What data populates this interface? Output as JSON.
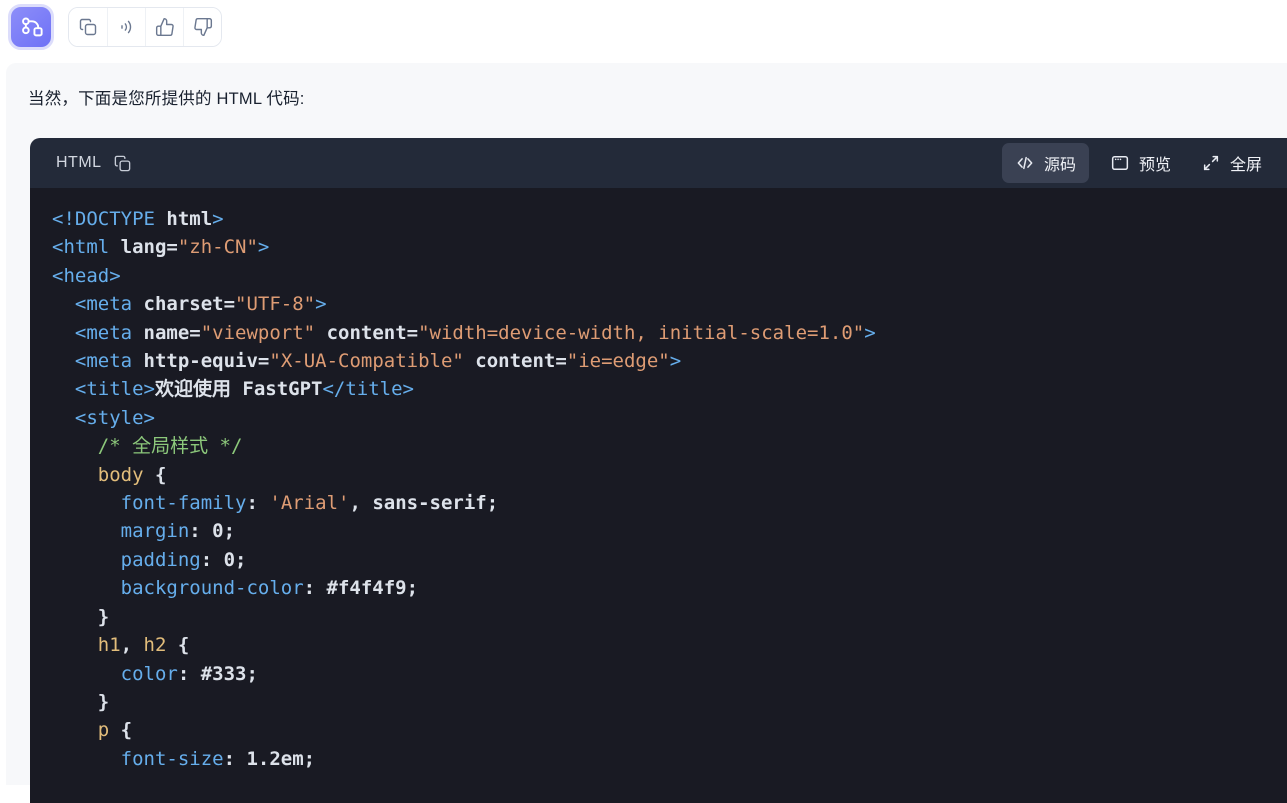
{
  "colors": {
    "avatar_purple": "#7a7df7",
    "avatar_ring": "#dcddfb",
    "bubble_bg": "#f7f8fa",
    "code_header_bg": "#232a39",
    "code_bg": "#191a23",
    "active_tab_bg": "#3a4153",
    "tag_blue": "#66aeec",
    "string_orange": "#de9c74",
    "comment_green": "#8cc87b",
    "selector_tan": "#e2bd7b",
    "code_text": "#dde2ea",
    "toolbar_icon_gray": "#6b7890"
  },
  "avatar": {
    "icon": "workflow-icon"
  },
  "toolbar": {
    "icons": [
      "copy-icon",
      "sound-icon",
      "thumbs-up-icon",
      "thumbs-down-icon"
    ]
  },
  "message": {
    "text": "当然，下面是您所提供的 HTML 代码:"
  },
  "code_block": {
    "language_label": "HTML",
    "header_icons": [
      "copy-icon",
      "code-icon",
      "window-icon",
      "expand-icon"
    ],
    "actions": {
      "source": {
        "label": "源码",
        "active": true
      },
      "preview": {
        "label": "预览",
        "active": false
      },
      "fullscreen": {
        "label": "全屏",
        "active": false
      }
    },
    "lines": [
      [
        [
          "t",
          "<!DOCTYPE "
        ],
        [
          "b",
          "html"
        ],
        [
          "t",
          ">"
        ]
      ],
      [
        [
          "t",
          "<html "
        ],
        [
          "b",
          "lang="
        ],
        [
          "s",
          "\"zh-CN\""
        ],
        [
          "t",
          ">"
        ]
      ],
      [
        [
          "t",
          "<head>"
        ]
      ],
      [
        [
          "b",
          "  "
        ],
        [
          "t",
          "<meta "
        ],
        [
          "b",
          "charset="
        ],
        [
          "s",
          "\"UTF-8\""
        ],
        [
          "t",
          ">"
        ]
      ],
      [
        [
          "b",
          "  "
        ],
        [
          "t",
          "<meta "
        ],
        [
          "b",
          "name="
        ],
        [
          "s",
          "\"viewport\""
        ],
        [
          "b",
          " content="
        ],
        [
          "s",
          "\"width=device-width, initial-scale=1.0\""
        ],
        [
          "t",
          ">"
        ]
      ],
      [
        [
          "b",
          "  "
        ],
        [
          "t",
          "<meta "
        ],
        [
          "b",
          "http-equiv="
        ],
        [
          "s",
          "\"X-UA-Compatible\""
        ],
        [
          "b",
          " content="
        ],
        [
          "s",
          "\"ie=edge\""
        ],
        [
          "t",
          ">"
        ]
      ],
      [
        [
          "b",
          "  "
        ],
        [
          "t",
          "<title>"
        ],
        [
          "b",
          "欢迎使用 FastGPT"
        ],
        [
          "t",
          "</title>"
        ]
      ],
      [
        [
          "b",
          "  "
        ],
        [
          "t",
          "<style>"
        ]
      ],
      [
        [
          "b",
          "    "
        ],
        [
          "c",
          "/* 全局样式 */"
        ]
      ],
      [
        [
          "b",
          "    "
        ],
        [
          "e",
          "body"
        ],
        [
          "b",
          " {"
        ]
      ],
      [
        [
          "b",
          "      "
        ],
        [
          "t",
          "font-family"
        ],
        [
          "b",
          ": "
        ],
        [
          "s",
          "'Arial'"
        ],
        [
          "b",
          ", sans-serif;"
        ]
      ],
      [
        [
          "b",
          "      "
        ],
        [
          "t",
          "margin"
        ],
        [
          "b",
          ": 0;"
        ]
      ],
      [
        [
          "b",
          "      "
        ],
        [
          "t",
          "padding"
        ],
        [
          "b",
          ": 0;"
        ]
      ],
      [
        [
          "b",
          "      "
        ],
        [
          "t",
          "background-color"
        ],
        [
          "b",
          ": #f4f4f9;"
        ]
      ],
      [
        [
          "b",
          "    }"
        ]
      ],
      [
        [
          "b",
          "    "
        ],
        [
          "e",
          "h1"
        ],
        [
          "b",
          ", "
        ],
        [
          "e",
          "h2"
        ],
        [
          "b",
          " {"
        ]
      ],
      [
        [
          "b",
          "      "
        ],
        [
          "t",
          "color"
        ],
        [
          "b",
          ": #333;"
        ]
      ],
      [
        [
          "b",
          "    }"
        ]
      ],
      [
        [
          "b",
          "    "
        ],
        [
          "e",
          "p"
        ],
        [
          "b",
          " {"
        ]
      ],
      [
        [
          "b",
          "      "
        ],
        [
          "t",
          "font-size"
        ],
        [
          "b",
          ": 1.2em;"
        ]
      ]
    ]
  }
}
